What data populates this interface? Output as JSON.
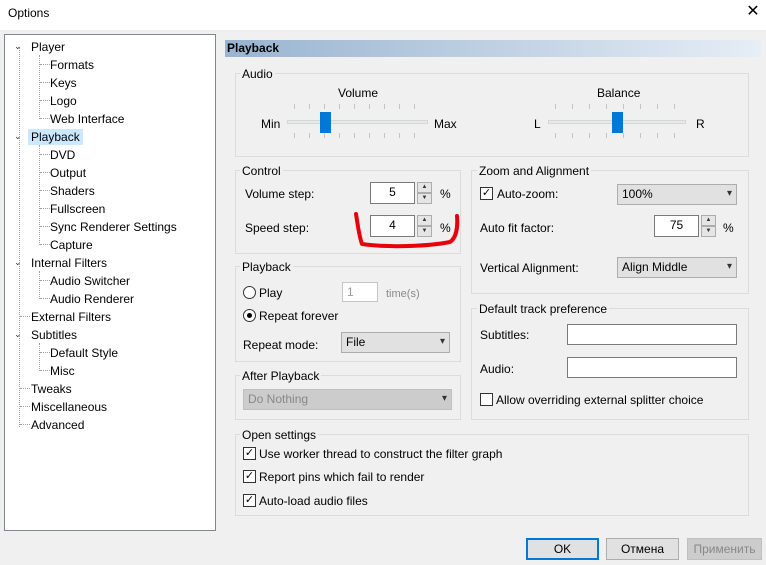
{
  "window": {
    "title": "Options"
  },
  "tree": {
    "items": [
      {
        "label": "Player"
      },
      {
        "label": "Formats"
      },
      {
        "label": "Keys"
      },
      {
        "label": "Logo"
      },
      {
        "label": "Web Interface"
      },
      {
        "label": "Playback"
      },
      {
        "label": "DVD"
      },
      {
        "label": "Output"
      },
      {
        "label": "Shaders"
      },
      {
        "label": "Fullscreen"
      },
      {
        "label": "Sync Renderer Settings"
      },
      {
        "label": "Capture"
      },
      {
        "label": "Internal Filters"
      },
      {
        "label": "Audio Switcher"
      },
      {
        "label": "Audio Renderer"
      },
      {
        "label": "External Filters"
      },
      {
        "label": "Subtitles"
      },
      {
        "label": "Default Style"
      },
      {
        "label": "Misc"
      },
      {
        "label": "Tweaks"
      },
      {
        "label": "Miscellaneous"
      },
      {
        "label": "Advanced"
      }
    ],
    "selected": "Playback"
  },
  "page": {
    "title": "Playback"
  },
  "audio": {
    "group_label": "Audio",
    "volume": {
      "label": "Volume",
      "min_label": "Min",
      "max_label": "Max",
      "level": 0.25
    },
    "balance": {
      "label": "Balance",
      "left_label": "L",
      "right_label": "R",
      "level": 0.5
    }
  },
  "control": {
    "group_label": "Control",
    "volume_step": {
      "label": "Volume step:",
      "value": "5",
      "unit": "%"
    },
    "speed_step": {
      "label": "Speed step:",
      "value": "4",
      "unit": "%"
    }
  },
  "zoom": {
    "group_label": "Zoom and Alignment",
    "auto_zoom": {
      "label": "Auto-zoom:",
      "checked": true,
      "value": "100%"
    },
    "auto_fit": {
      "label": "Auto fit factor:",
      "value": "75",
      "unit": "%"
    },
    "vertical": {
      "label": "Vertical Alignment:",
      "value": "Align Middle"
    }
  },
  "playback": {
    "group_label": "Playback",
    "play": {
      "label": "Play",
      "value": "1",
      "unit": "time(s)"
    },
    "repeat_forever": {
      "label": "Repeat forever"
    },
    "repeat_mode": {
      "label": "Repeat mode:",
      "value": "File"
    }
  },
  "track_pref": {
    "group_label": "Default track preference",
    "subtitles": {
      "label": "Subtitles:",
      "value": ""
    },
    "audio": {
      "label": "Audio:",
      "value": ""
    },
    "allow_override": {
      "label": "Allow overriding external splitter choice",
      "checked": false
    }
  },
  "after_playback": {
    "group_label": "After Playback",
    "value": "Do Nothing"
  },
  "open_settings": {
    "group_label": "Open settings",
    "options": [
      {
        "label": "Use worker thread to construct the filter graph",
        "checked": true
      },
      {
        "label": "Report pins which fail to render",
        "checked": true
      },
      {
        "label": "Auto-load audio files",
        "checked": true
      }
    ]
  },
  "buttons": {
    "ok": "OK",
    "cancel": "Отмена",
    "apply": "Применить"
  },
  "colors": {
    "annotation": "#e8000a",
    "accent": "#0078d7",
    "selection": "#cce8ff"
  }
}
